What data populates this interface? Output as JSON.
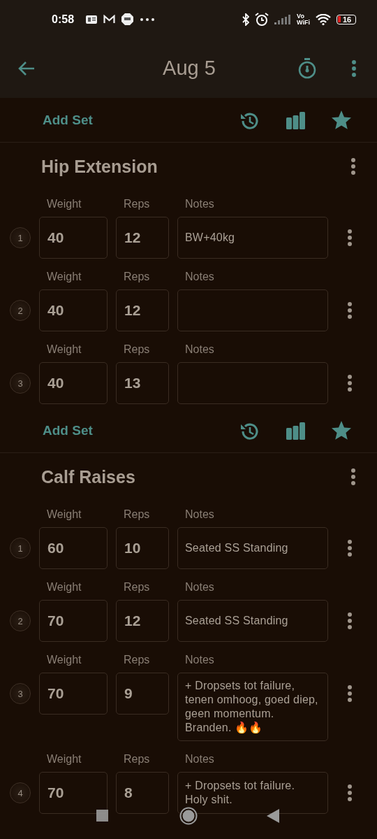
{
  "status_bar": {
    "time": "0:58",
    "battery": "16",
    "vowifi_top": "Vo",
    "vowifi_bottom": "WiFi"
  },
  "app_bar": {
    "title": "Aug 5"
  },
  "content": [
    {
      "kind": "toolbar",
      "label": "Add Set"
    },
    {
      "kind": "exercise",
      "name": "Hip Extension",
      "sets": [
        {
          "number": "1",
          "weight_label": "Weight",
          "weight": "40",
          "reps_label": "Reps",
          "reps": "12",
          "notes_label": "Notes",
          "notes": "BW+40kg"
        },
        {
          "number": "2",
          "weight_label": "Weight",
          "weight": "40",
          "reps_label": "Reps",
          "reps": "12",
          "notes_label": "Notes"
        },
        {
          "number": "3",
          "weight_label": "Weight",
          "weight": "40",
          "reps_label": "Reps",
          "reps": "13",
          "notes_label": "Notes"
        }
      ]
    },
    {
      "kind": "toolbar",
      "label": "Add Set"
    },
    {
      "kind": "exercise",
      "name": "Calf Raises",
      "sets": [
        {
          "number": "1",
          "weight_label": "Weight",
          "weight": "60",
          "reps_label": "Reps",
          "reps": "10",
          "notes_label": "Notes",
          "notes": "Seated SS Standing"
        },
        {
          "number": "2",
          "weight_label": "Weight",
          "weight": "70",
          "reps_label": "Reps",
          "reps": "12",
          "notes_label": "Notes",
          "notes": "Seated SS Standing"
        },
        {
          "number": "3",
          "weight_label": "Weight",
          "weight": "70",
          "reps_label": "Reps",
          "reps": "9",
          "notes_label": "Notes",
          "notes": "+ Dropsets tot failure, tenen omhoog, goed diep, geen momentum. Branden. 🔥🔥"
        },
        {
          "number": "4",
          "weight_label": "Weight",
          "weight": "70",
          "reps_label": "Reps",
          "reps": "8",
          "notes_label": "Notes",
          "notes": "+ Dropsets tot failure. Holy shit."
        }
      ]
    }
  ]
}
